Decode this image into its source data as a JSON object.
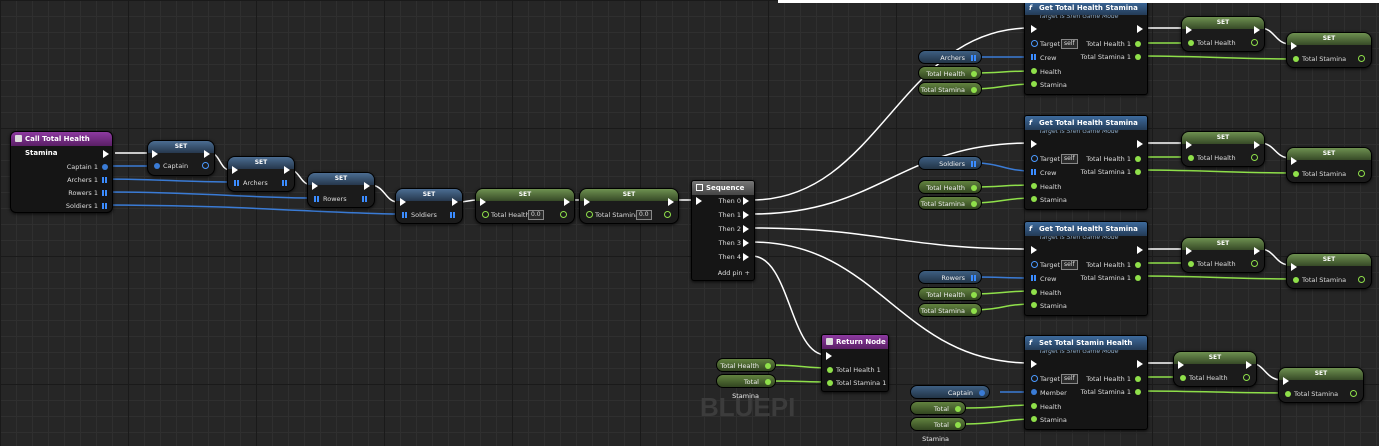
{
  "watermark": "BLUEPI",
  "colors": {
    "exec": "#ffffff",
    "object": "#3a7bd5",
    "float": "#8fe04a"
  },
  "event_node": {
    "title": "Call Total Health Stamina",
    "outputs": [
      "Captain 1",
      "Archers 1",
      "Rowers 1",
      "Soldiers 1"
    ]
  },
  "set_nodes": {
    "set1": {
      "title": "SET",
      "pin": "Captain"
    },
    "set2": {
      "title": "SET",
      "pin": "Archers"
    },
    "set3": {
      "title": "SET",
      "pin": "Rowers"
    },
    "set4": {
      "title": "SET",
      "pin": "Soldiers"
    },
    "set5": {
      "title": "SET",
      "pin": "Total Health",
      "value": "0.0"
    },
    "set6": {
      "title": "SET",
      "pin": "Total Stamina",
      "value": "0.0"
    }
  },
  "sequence": {
    "title": "Sequence",
    "outputs": [
      "Then 0",
      "Then 1",
      "Then 2",
      "Then 3",
      "Then 4"
    ],
    "add_pin": "Add pin"
  },
  "functions": [
    {
      "title": "Get Total Health Stamina",
      "subtitle": "Target is Sren Game Mode",
      "target": "Target",
      "self": "self",
      "crew": "Crew",
      "health": "Health",
      "stamina": "Stamina",
      "out1": "Total Health 1",
      "out2": "Total Stamina 1"
    },
    {
      "title": "Get Total Health Stamina",
      "subtitle": "Target is Sren Game Mode",
      "target": "Target",
      "self": "self",
      "crew": "Crew",
      "health": "Health",
      "stamina": "Stamina",
      "out1": "Total Health 1",
      "out2": "Total Stamina 1"
    },
    {
      "title": "Get Total Health Stamina",
      "subtitle": "Target is Sren Game Mode",
      "target": "Target",
      "self": "self",
      "crew": "Crew",
      "health": "Health",
      "stamina": "Stamina",
      "out1": "Total Health 1",
      "out2": "Total Stamina 1"
    },
    {
      "title": "Set Total Stamin Health",
      "subtitle": "Target is Sren Game Mode",
      "target": "Target",
      "self": "self",
      "crew": "Member",
      "health": "Health",
      "stamina": "Stamina",
      "out1": "Total Health 1",
      "out2": "Total Stamina 1"
    }
  ],
  "input_vars": [
    [
      "Archers",
      "Total Health",
      "Total Stamina"
    ],
    [
      "Soldiers",
      "Total Health",
      "Total Stamina"
    ],
    [
      "Rowers",
      "Total Health",
      "Total Stamina"
    ],
    [
      "Captain",
      "Total Health",
      "Total Stamina"
    ]
  ],
  "right_sets": [
    {
      "a_title": "SET",
      "a_pin": "Total Health",
      "b_title": "SET",
      "b_pin": "Total Stamina"
    },
    {
      "a_title": "SET",
      "a_pin": "Total Health",
      "b_title": "SET",
      "b_pin": "Total Stamina"
    },
    {
      "a_title": "SET",
      "a_pin": "Total Health",
      "b_title": "SET",
      "b_pin": "Total Stamina"
    },
    {
      "a_title": "SET",
      "a_pin": "Total Health",
      "b_title": "SET",
      "b_pin": "Total Stamina"
    }
  ],
  "return_node": {
    "title": "Return Node",
    "inputs": [
      "Total Health 1",
      "Total Stamina 1"
    ],
    "vars": [
      "Total Health",
      "Total Stamina"
    ]
  }
}
